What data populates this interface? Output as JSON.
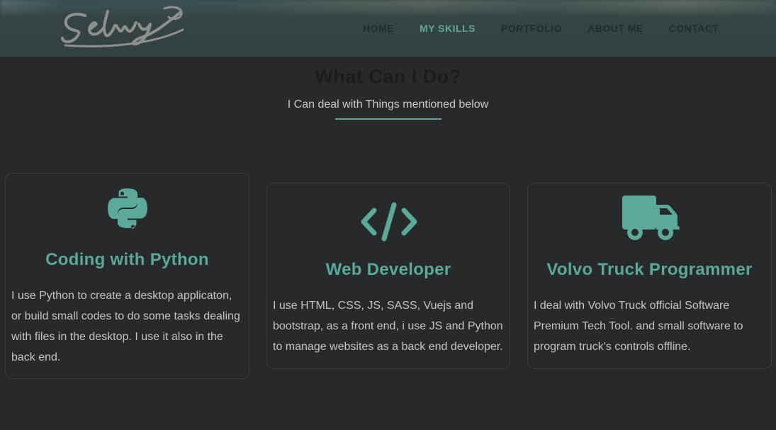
{
  "header": {
    "logo_text": "Selwy",
    "nav": [
      {
        "label": "HOME"
      },
      {
        "label": "MY SKILLS",
        "active": true
      },
      {
        "label": "PORTFOLIO"
      },
      {
        "label": "ABOUT ME"
      },
      {
        "label": "CONTACT"
      }
    ]
  },
  "section": {
    "title": "What Can I Do?",
    "subtitle": "I Can deal with Things mentioned below"
  },
  "cards": [
    {
      "icon": "python-icon",
      "title": "Coding with Python",
      "text": "I use Python to create a desktop applicaton, or build small codes to do some tasks dealing with files in the desktop. I use it also in the back end."
    },
    {
      "icon": "code-icon",
      "title": "Web Developer",
      "text": "I use HTML, CSS, JS, SASS, Vuejs and bootstrap, as a front end, i use JS and Python to manage websites as a back end developer."
    },
    {
      "icon": "truck-icon",
      "title": "Volvo Truck Programmer",
      "text": "I deal with Volvo Truck official Software Premium Tech Tool. and small software to program truck's controls offline."
    }
  ],
  "colors": {
    "accent": "#5aa99b",
    "background": "#28292b",
    "header": "#334241"
  }
}
